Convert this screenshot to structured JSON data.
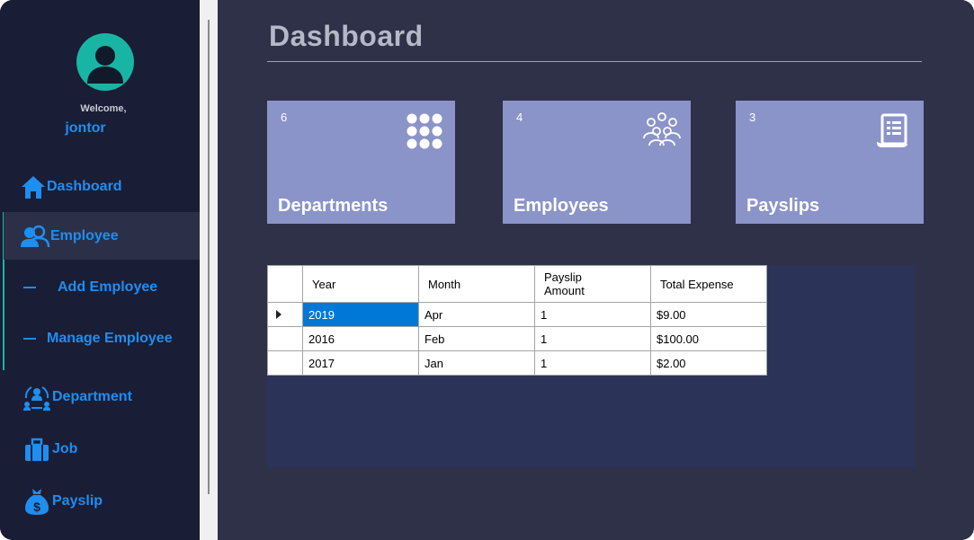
{
  "sidebar": {
    "welcome": "Welcome,",
    "username": "jontor",
    "items": [
      {
        "label": "Dashboard",
        "icon": "home-icon"
      },
      {
        "label": "Employee",
        "icon": "users-icon"
      },
      {
        "label": "Add Employee"
      },
      {
        "label": "Manage Employee"
      },
      {
        "label": "Department",
        "icon": "department-icon"
      },
      {
        "label": "Job",
        "icon": "briefcase-icon"
      },
      {
        "label": "Payslip",
        "icon": "money-bag-icon"
      }
    ]
  },
  "main": {
    "title": "Dashboard",
    "cards": [
      {
        "count": "6",
        "label": "Departments",
        "icon": "grid-dots-icon"
      },
      {
        "count": "4",
        "label": "Employees",
        "icon": "people-group-icon"
      },
      {
        "count": "3",
        "label": "Payslips",
        "icon": "receipt-icon"
      }
    ],
    "table": {
      "headers": [
        "Year",
        "Month",
        "Payslip Amount",
        "Total Expense"
      ],
      "rows": [
        [
          "2019",
          "Apr",
          "1",
          "$9.00"
        ],
        [
          "2016",
          "Feb",
          "1",
          "$100.00"
        ],
        [
          "2017",
          "Jan",
          "1",
          "$2.00"
        ]
      ]
    }
  },
  "colors": {
    "accent": "#1e8ef0",
    "sidebar_bg": "#191d35",
    "main_bg": "#2e3148",
    "card_bg": "#8b94c8",
    "avatar": "#19b5a4"
  }
}
